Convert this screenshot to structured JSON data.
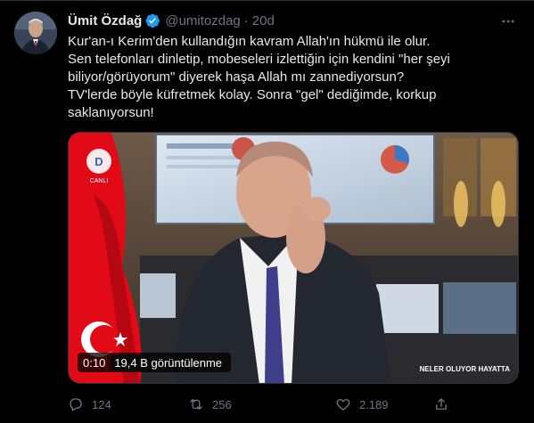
{
  "tweet": {
    "author_name": "Ümit Özdağ",
    "handle": "@umitozdag",
    "separator": "·",
    "time": "20d",
    "text_lines": [
      "Kur'an-ı Kerim'den kullandığın kavram Allah'ın hükmü ile olur.",
      "Sen telefonları dinletip, mobeseleri izlettiğin için kendini \"her şeyi",
      "biliyor/görüyorum\" diyerek haşa Allah mı zannediyorsun?",
      "TV'lerde böyle küfretmek kolay. Sonra \"gel\" dediğimde, korkup",
      "saklanıyorsun!"
    ]
  },
  "media": {
    "channel_label": "CANLI",
    "show_caption": "NELER OLUYOR HAYATTA",
    "video_time": "0:10",
    "views": "19,4 B görüntülenme"
  },
  "actions": {
    "replies": "124",
    "retweets": "256",
    "likes": "2.189"
  },
  "colors": {
    "background": "#000000",
    "text_primary": "#e7e9ea",
    "text_secondary": "#71767b",
    "verified": "#1d9bf0",
    "flag_red": "#e30a17"
  }
}
